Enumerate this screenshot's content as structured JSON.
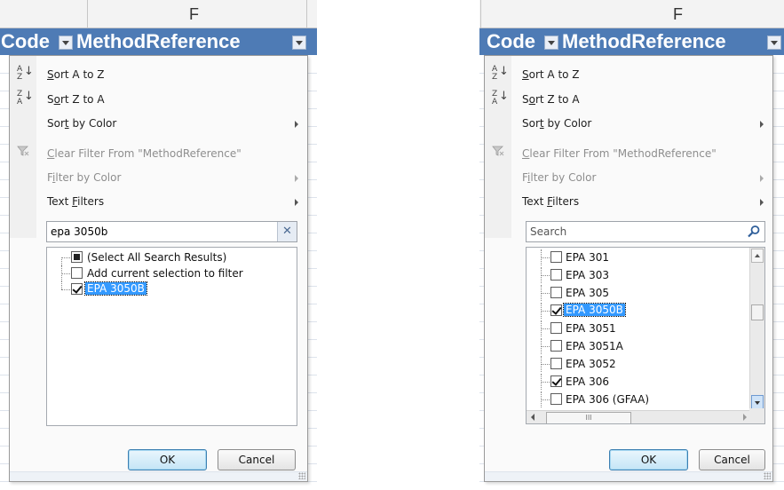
{
  "left": {
    "column_letter": "F",
    "headers": {
      "code": "Code",
      "method_reference": "MethodReference"
    },
    "menu": {
      "sort_az": {
        "pre": "",
        "u": "S",
        "post": "ort A to Z"
      },
      "sort_za": {
        "pre": "S",
        "u": "o",
        "post": "rt Z to A"
      },
      "sort_color": {
        "pre": "Sor",
        "u": "t",
        "post": " by Color"
      },
      "clear_filter": {
        "pre": "",
        "u": "C",
        "post": "lear Filter From \"MethodReference\""
      },
      "filter_color": {
        "pre": "F",
        "u": "i",
        "post": "lter by Color"
      },
      "text_filters": {
        "pre": "Text ",
        "u": "F",
        "post": "ilters"
      }
    },
    "search": {
      "value": "epa 3050b",
      "placeholder": "Search"
    },
    "list": [
      {
        "label": "(Select All Search Results)",
        "state": "partial"
      },
      {
        "label": "Add current selection to filter",
        "state": "unchecked"
      },
      {
        "label": "EPA 3050B",
        "state": "checked"
      }
    ],
    "buttons": {
      "ok": "OK",
      "cancel": "Cancel"
    }
  },
  "right": {
    "column_letter": "F",
    "headers": {
      "code": "Code",
      "method_reference": "MethodReference"
    },
    "menu": {
      "sort_az": {
        "pre": "",
        "u": "S",
        "post": "ort A to Z"
      },
      "sort_za": {
        "pre": "S",
        "u": "o",
        "post": "rt Z to A"
      },
      "sort_color": {
        "pre": "Sor",
        "u": "t",
        "post": " by Color"
      },
      "clear_filter": {
        "pre": "",
        "u": "C",
        "post": "lear Filter From \"MethodReference\""
      },
      "filter_color": {
        "pre": "F",
        "u": "i",
        "post": "lter by Color"
      },
      "text_filters": {
        "pre": "Text ",
        "u": "F",
        "post": "ilters"
      }
    },
    "search": {
      "value": "",
      "placeholder": "Search"
    },
    "list": [
      {
        "label": "EPA 301",
        "state": "unchecked"
      },
      {
        "label": "EPA 303",
        "state": "unchecked"
      },
      {
        "label": "EPA 305",
        "state": "unchecked"
      },
      {
        "label": "EPA 3050B",
        "state": "checked"
      },
      {
        "label": "EPA 3051",
        "state": "unchecked"
      },
      {
        "label": "EPA 3051A",
        "state": "unchecked"
      },
      {
        "label": "EPA 3052",
        "state": "unchecked"
      },
      {
        "label": "EPA 306",
        "state": "checked"
      },
      {
        "label": "EPA 306 (GFAA)",
        "state": "unchecked"
      }
    ],
    "buttons": {
      "ok": "OK",
      "cancel": "Cancel"
    }
  },
  "colors": {
    "header_blue": "#4e7bb5",
    "selection_blue": "#3399ff",
    "menu_bg": "#fafafa"
  },
  "icons": {
    "sort_az": "sort-ascending-icon",
    "sort_za": "sort-descending-icon",
    "clear_filter": "clear-filter-icon",
    "search": "magnifier-icon",
    "clear_search": "close-icon"
  }
}
